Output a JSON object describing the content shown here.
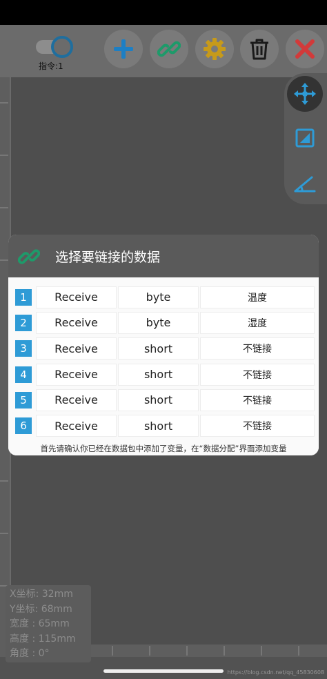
{
  "toolbar": {
    "instruction_label": "指令:1",
    "buttons": [
      {
        "name": "add",
        "icon": "plus-icon"
      },
      {
        "name": "link",
        "icon": "link-icon"
      },
      {
        "name": "settings",
        "icon": "gear-icon"
      },
      {
        "name": "delete",
        "icon": "trash-icon"
      },
      {
        "name": "close",
        "icon": "close-icon"
      }
    ]
  },
  "side_tools": [
    "move-icon",
    "resize-icon",
    "angle-icon"
  ],
  "dialog": {
    "title": "选择要链接的数据",
    "rows": [
      {
        "index": "1",
        "direction": "Receive",
        "type": "byte",
        "link": "温度"
      },
      {
        "index": "2",
        "direction": "Receive",
        "type": "byte",
        "link": "湿度"
      },
      {
        "index": "3",
        "direction": "Receive",
        "type": "short",
        "link": "不链接"
      },
      {
        "index": "4",
        "direction": "Receive",
        "type": "short",
        "link": "不链接"
      },
      {
        "index": "5",
        "direction": "Receive",
        "type": "short",
        "link": "不链接"
      },
      {
        "index": "6",
        "direction": "Receive",
        "type": "short",
        "link": "不链接"
      }
    ],
    "hint": "首先请确认你已经在数据包中添加了变量，在“数据分配”界面添加变量"
  },
  "info": {
    "x": "X坐标: 32mm",
    "y": "Y坐标: 68mm",
    "width": "宽度 : 65mm",
    "height": "高度 : 115mm",
    "angle": "角度 : 0°"
  },
  "watermark": "https://blog.csdn.net/qq_45830608",
  "colors": {
    "accent_blue": "#2e9bd6",
    "link_green": "#1e9a6a",
    "delete_red": "#d23a3a",
    "gear_gold": "#c79a1a"
  }
}
